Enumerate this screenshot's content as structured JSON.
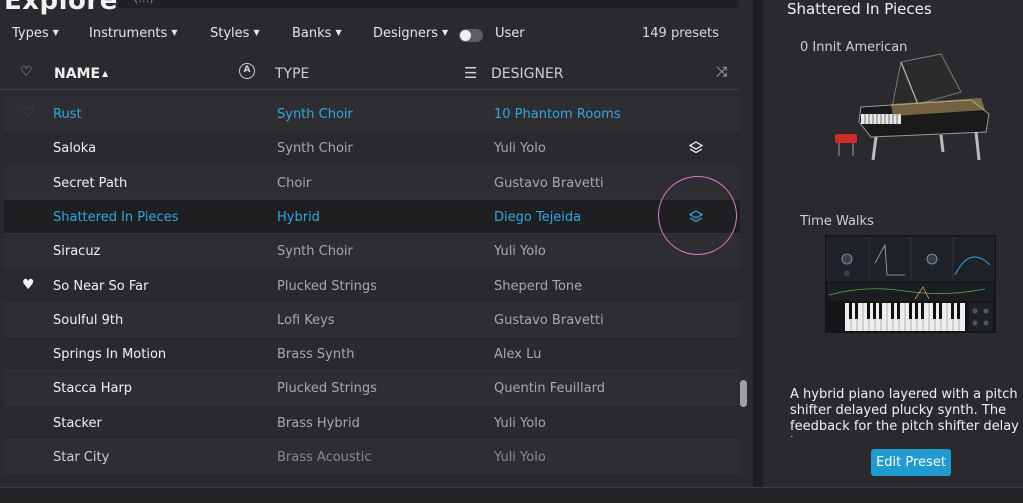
{
  "header": {
    "title": "Explore",
    "search_glyph": "(…)"
  },
  "filters": {
    "types": "Types",
    "instruments": "Instruments",
    "styles": "Styles",
    "banks": "Banks",
    "designers": "Designers",
    "user_label": "User",
    "user_toggle_on": false,
    "preset_count": "149 presets"
  },
  "columns": {
    "name": "NAME",
    "type": "TYPE",
    "designer": "DESIGNER"
  },
  "rows": [
    {
      "name": "Rust",
      "type": "Synth Choir",
      "designer": "10 Phantom Rooms",
      "favorite": true,
      "highlighted": true
    },
    {
      "name": "Saloka",
      "type": "Synth Choir",
      "designer": "Yuli Yolo",
      "layered": true
    },
    {
      "name": "Secret Path",
      "type": "Choir",
      "designer": "Gustavo Bravetti"
    },
    {
      "name": "Shattered In Pieces",
      "type": "Hybrid",
      "designer": "Diego Tejeida",
      "selected": true,
      "layered": true
    },
    {
      "name": "Siracuz",
      "type": "Synth Choir",
      "designer": "Yuli Yolo"
    },
    {
      "name": "So Near So Far",
      "type": "Plucked Strings",
      "designer": "Sheperd Tone",
      "favorite": true
    },
    {
      "name": "Soulful 9th",
      "type": "Lofi Keys",
      "designer": "Gustavo Bravetti"
    },
    {
      "name": "Springs In Motion",
      "type": "Brass Synth",
      "designer": "Alex Lu"
    },
    {
      "name": "Stacca Harp",
      "type": "Plucked Strings",
      "designer": "Quentin Feuillard"
    },
    {
      "name": "Stacker",
      "type": "Brass Hybrid",
      "designer": "Yuli Yolo"
    },
    {
      "name": "Star City",
      "type": "Brass Acoustic",
      "designer": "Yuli Yolo"
    }
  ],
  "detail": {
    "title": "Shattered In Pieces",
    "part1": "0 Innit American",
    "part2": "Time Walks",
    "description": "A hybrid piano layered with a pitch shifter delayed plucky synth. The feedback for the pitch shifter delay is",
    "edit_button": "Edit Preset"
  },
  "colors": {
    "accent": "#2ea8e0",
    "annotation": "#d97bc7",
    "button": "#1f9bd0"
  }
}
